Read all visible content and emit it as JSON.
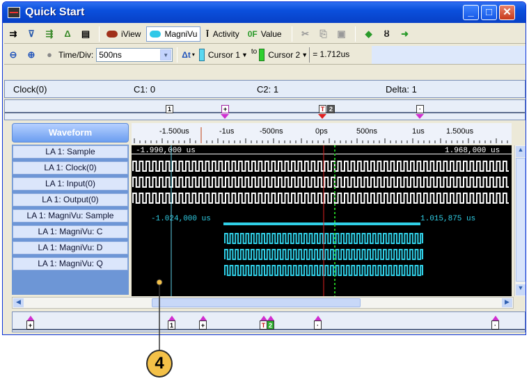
{
  "window": {
    "title": "Quick Start"
  },
  "toolbar1": {
    "iview": "iView",
    "magnivu": "MagniVu",
    "activity": "Activity",
    "value_prefix": "0F",
    "value": "Value"
  },
  "toolbar2": {
    "timediv_label": "Time/Div:",
    "timediv_value": "500ns",
    "delta_label": "Δt",
    "cursor1": "Cursor 1",
    "to": "to",
    "cursor2": "Cursor 2",
    "delta_value": "= 1.712us"
  },
  "cursor_bar": {
    "clock": "Clock(0)",
    "c1": "C1: 0",
    "c2": "C2: 1",
    "delta": "Delta: 1"
  },
  "waveform": {
    "header": "Waveform",
    "ticks": [
      "-1.500us",
      "-1us",
      "-500ns",
      "0ps",
      "500ns",
      "1us",
      "1.500us"
    ],
    "signals": [
      "LA 1: Sample",
      "LA 1: Clock(0)",
      "LA 1: Input(0)",
      "LA 1: Output(0)",
      "LA 1: MagniVu: Sample",
      "LA 1: MagniVu: C",
      "LA 1: MagniVu: D",
      "LA 1: MagniVu: Q"
    ],
    "left_time": "-1.990,000 us",
    "right_time": "1.968,000 us",
    "mv_left": "-1.024,000 us",
    "mv_right": "1.015,875 us"
  },
  "markers": {
    "m1": "1",
    "m2": "2",
    "callout": "4"
  },
  "colors": {
    "cursor1": "#60d0e8",
    "cursor2": "#20c020",
    "trigger": "#e02020",
    "magnivu": "#30d0e8"
  }
}
